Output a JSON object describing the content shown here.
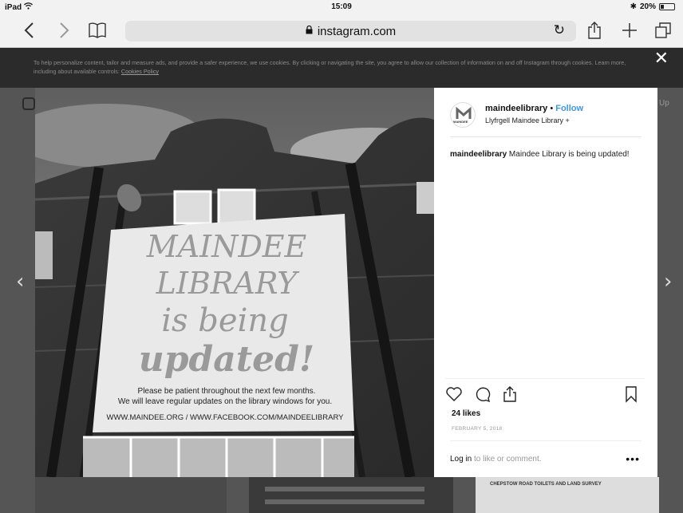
{
  "status_bar": {
    "device": "iPad",
    "time": "15:09",
    "battery": "20%"
  },
  "browser": {
    "url": "instagram.com"
  },
  "cookie_banner": {
    "text": "To help personalize content, tailor and measure ads, and provide a safer experience, we use cookies. By clicking or navigating the site, you agree to allow our collection of information on and off Instagram through cookies. Learn more, including about available controls:",
    "link": "Cookies Policy"
  },
  "background": {
    "right_text": "Up"
  },
  "photo": {
    "banner_line1": "MAINDEE",
    "banner_line2": "LIBRARY",
    "banner_line3": "is being",
    "banner_line4": "updated!",
    "banner_small1": "Please be patient throughout the next few months.",
    "banner_small2": "We will leave regular updates on the library windows for you.",
    "banner_url": "WWW.MAINDEE.ORG / WWW.FACEBOOK.COM/MAINDEELIBRARY"
  },
  "post": {
    "username": "maindeelibrary",
    "separator": " • ",
    "follow": "Follow",
    "location": "Llyfrgell Maindee Library +",
    "avatar_label": "MAINDEE",
    "caption_user": "maindeelibrary",
    "caption_text": " Maindee Library is being updated!",
    "likes": "24 likes",
    "date": "FEBRUARY 5, 2018",
    "login_link": "Log in",
    "login_text": " to like or comment.",
    "more": "•••"
  },
  "thumbnail": {
    "sign_text": "CHEPSTOW ROAD TOILETS AND LAND SURVEY"
  }
}
